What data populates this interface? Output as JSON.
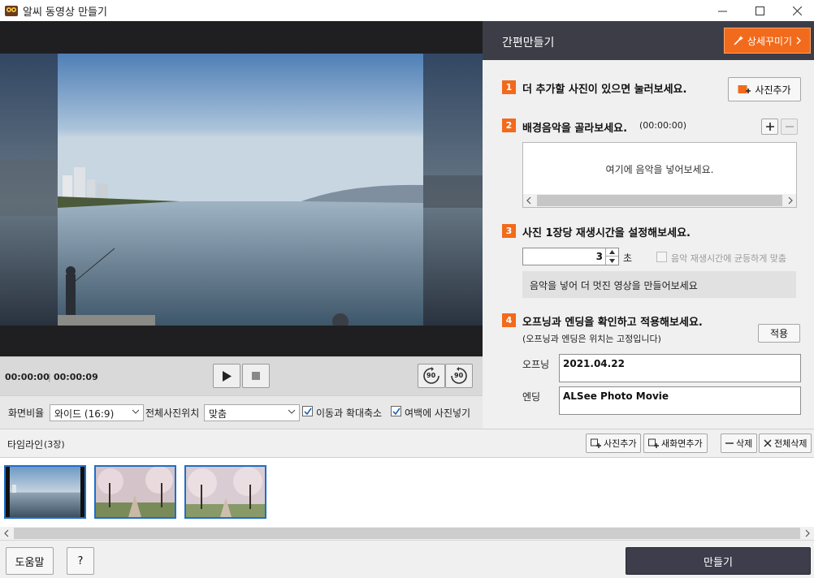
{
  "window": {
    "title": "알씨 동영상 만들기"
  },
  "player": {
    "current_time": "00:00:00",
    "total_time": "00:00:09",
    "rotate_left_label": "90",
    "rotate_right_label": "90"
  },
  "options": {
    "ratio_label": "화면비율",
    "ratio_value": "와이드 (16:9)",
    "position_label": "전체사진위치",
    "position_value": "맞춤",
    "motion_label": "이동과 확대축소",
    "margin_label": "여백에 사진넣기"
  },
  "panel": {
    "title": "간편만들기",
    "detail_button": "상세꾸미기",
    "step1": {
      "num": "1",
      "text": "더 추가할 사진이 있으면 눌러보세요.",
      "button": "사진추가"
    },
    "step2": {
      "num": "2",
      "text": "배경음악을 골라보세요.",
      "duration": "(00:00:00)",
      "placeholder": "여기에 음악을 넣어보세요."
    },
    "step3": {
      "num": "3",
      "text": "사진 1장당 재생시간을 설정해보세요.",
      "seconds_value": "3",
      "unit": "초",
      "sync_label": "음악 재생시간에 균등하게 맞춤",
      "tip": "음악을 넣어 더 멋진 영상을 만들어보세요"
    },
    "step4": {
      "num": "4",
      "text": "오프닝과 엔딩을 확인하고 적용해보세요.",
      "note": "(오프닝과 엔딩은 위치는 고정입니다)",
      "apply_button": "적용",
      "opening_label": "오프닝",
      "opening_value": "2021.04.22",
      "ending_label": "엔딩",
      "ending_value": "ALSee Photo Movie"
    }
  },
  "timeline": {
    "title": "타임라인",
    "count": "(3장)",
    "add_photo": "사진추가",
    "new_screen": "새화면추가",
    "delete": "삭제",
    "delete_all": "전체삭제"
  },
  "footer": {
    "help": "도움말",
    "question": "?",
    "make": "만들기"
  },
  "colors": {
    "accent": "#f26a1b",
    "dark": "#3d3d48",
    "selection": "#1d6fc8"
  }
}
